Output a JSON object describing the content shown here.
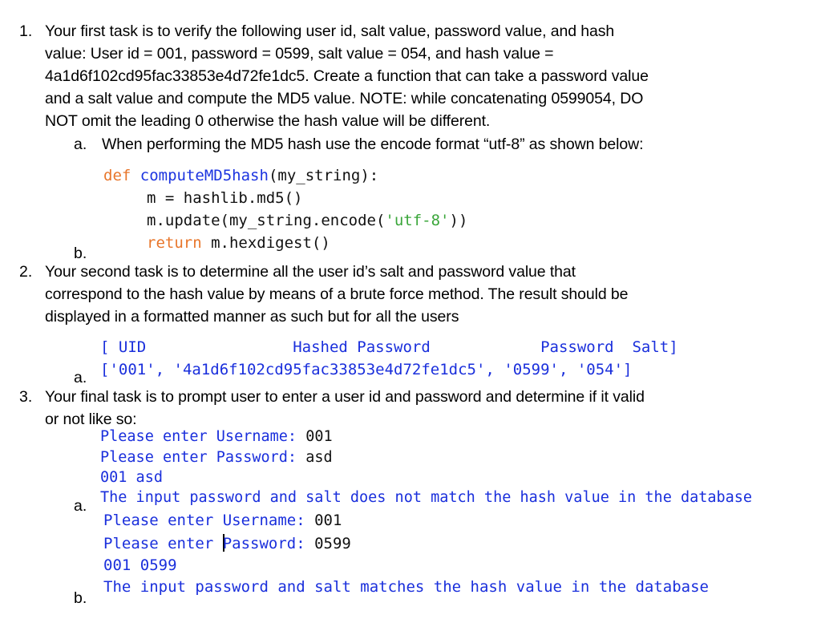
{
  "task1": {
    "number": "1.",
    "lines": [
      "Your first task is to verify the following user id, salt value, password value, and hash",
      "value: User id = 001, password = 0599, salt value = 054, and hash value =",
      "4a1d6f102cd95fac33853e4d72fe1dc5. Create a function that can take a password value",
      "and a salt value and compute the MD5 value. NOTE: while concatenating 0599054, DO",
      "NOT omit the leading 0 otherwise the hash value will be different."
    ],
    "sub_a": {
      "label": "a.",
      "text": "When performing the MD5 hash use the encode format “utf-8” as shown below:"
    },
    "code": {
      "def_kw": "def",
      "fn_name": "computeMD5hash",
      "signature_rest": "(my_string):",
      "line2": "m = hashlib.md5()",
      "line3_pre": "m.update(my_string.encode(",
      "line3_str": "'utf-8'",
      "line3_post": "))",
      "return_kw": "return",
      "return_rest": " m.hexdigest()"
    },
    "sub_b": {
      "label": "b."
    }
  },
  "task2": {
    "number": "2.",
    "lines": [
      "Your second task is to determine all the user id’s salt and password value that",
      "correspond to the hash value by means of a brute force method. The result should be",
      "displayed in a formatted manner as such but for all the users"
    ],
    "sub_a": {
      "label": "a."
    },
    "output": {
      "header": "[ UID                Hashed Password            Password  Salt]",
      "row": "['001', '4a1d6f102cd95fac33853e4d72fe1dc5', '0599', '054']"
    }
  },
  "task3": {
    "number": "3.",
    "lines": [
      "Your final task is to prompt user to enter a user id and password and determine if it valid",
      "or not like so:"
    ],
    "example_a": {
      "label": "a.",
      "username_prompt": "Please enter Username: ",
      "username_value": "001",
      "password_prompt": "Please enter Password: ",
      "password_value": "asd",
      "echo": "001 asd",
      "result": "The input password and salt does not match the hash value in the database"
    },
    "example_b": {
      "label": "b.",
      "username_prompt": "Please enter Username: ",
      "username_value": "001",
      "password_prompt_pre": "Please enter ",
      "password_prompt_post": "Password: ",
      "password_value": "0599",
      "echo": "001 0599",
      "result": "The input password and salt matches the hash value in the database"
    }
  },
  "colors": {
    "keyword": "#e8762b",
    "function_name": "#1c34e0",
    "string": "#3aa63a",
    "console_output": "#1a2fdc"
  }
}
